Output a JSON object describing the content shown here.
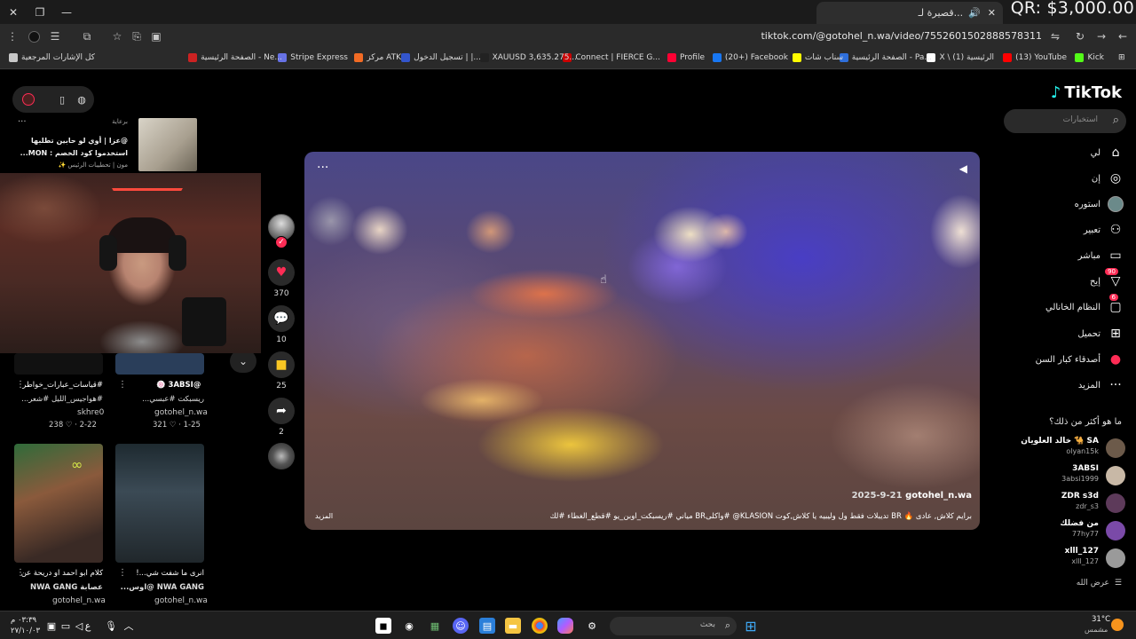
{
  "overlay": {
    "qr_text": "QR: $3,000.00"
  },
  "browser": {
    "tab_title": "...قصيرة لـ",
    "url": "tiktok.com/@gotohel_n.wa/video/7552601502888578311",
    "bookmarks": [
      {
        "label": "Kick",
        "color": "#53fc18"
      },
      {
        "label": "(13) YouTube",
        "color": "#ff0000"
      },
      {
        "label": "X \\ (1) الرئيسية",
        "color": "#ffffff"
      },
      {
        "label": "الصفحة الرئيسية - Pa...",
        "color": "#2f6fdb"
      },
      {
        "label": "سناب شات",
        "color": "#fffc00"
      },
      {
        "label": "(20+) Facebook",
        "color": "#1877f2"
      },
      {
        "label": "Profile",
        "color": "#ff0033"
      },
      {
        "label": "Connect | FIERCE G...",
        "color": "#cc0000"
      },
      {
        "label": "XAUUSD 3,635.275...",
        "color": "#222222"
      },
      {
        "label": "تسجيل الدخول | |...",
        "color": "#3355cc"
      },
      {
        "label": "مركز ATK",
        "color": "#5566dd"
      },
      {
        "label": "Stripe Express",
        "color": "#f26b24"
      },
      {
        "label": "الصفحة الرئيسية - Ne...",
        "color": "#6772e5"
      },
      {
        "label": "كل الإشارات المرجعية",
        "color": "#c8c8c8"
      }
    ]
  },
  "tiktok": {
    "logo": "TikTok",
    "search_placeholder": "استخبارات",
    "nav": [
      {
        "label": "لي",
        "icon": "home-icon"
      },
      {
        "label": "إن",
        "icon": "explore-icon"
      },
      {
        "label": "استوره",
        "icon": "profile-avatar-icon"
      },
      {
        "label": "تعبير",
        "icon": "following-icon"
      },
      {
        "label": "مباشر",
        "icon": "live-icon"
      },
      {
        "label": "إيح",
        "icon": "activity-icon",
        "badge": "90"
      },
      {
        "label": "النظام الخانالي",
        "icon": "messages-icon",
        "badge": "6"
      },
      {
        "label": "تحميل",
        "icon": "upload-icon"
      },
      {
        "label": "أصدقاء كبار السن",
        "icon": "friends-icon"
      },
      {
        "label": "المزيد",
        "icon": "more-icon"
      }
    ],
    "suggested_title": "ما هو أكثر من ذلك؟",
    "suggested": [
      {
        "name": "خالد العلويان 🐪 SA",
        "user": "olyan15k",
        "avatar_color": "#6c5a4a"
      },
      {
        "name": "3ABSI",
        "user": "3absi1999",
        "avatar_color": "#c8b8a6"
      },
      {
        "name": "ZDR s3d",
        "user": "zdr_s3",
        "avatar_color": "#5d3a5a"
      },
      {
        "name": "من فضلك",
        "user": "77hy77",
        "avatar_color": "#7a4aa8"
      },
      {
        "name": "xlll_127",
        "user": "xlll_127",
        "avatar_color": "#9a9a9a"
      }
    ],
    "show_all": "عرض الله"
  },
  "video": {
    "author": "gotohel_n.wa",
    "date": "2025-9-21",
    "caption": "برايم كلاش, عادى 🔥 BR تديبلات فقط ول وليبيه يا كلاش,كوت KLASION@ #واكلىBR مياني #ريسبكت_اوبن_يو #قطع_الغطاء #لك",
    "more_label": "المزيد",
    "likes": "370",
    "comments": "10",
    "saves": "25",
    "shares": "2"
  },
  "left": {
    "ad_label": "برعاية",
    "ad_line1": "@عزا | أوي لو حابين تطلبها",
    "ad_line2": "استخدموا كود الخصم : MON...",
    "ad_line3": "مون | تحطيبات الرئيس ✨",
    "grid": [
      {
        "title": "#قياسات_عبارات_خواطر",
        "sub": "#هواجيس_الليل #شعر...",
        "user": "skhre0",
        "stats": "238 ♡ · 2-22"
      },
      {
        "title": "@3ABSI 🍥",
        "sub": "ريسبكت #عبسي...",
        "user": "gotohel_n.wa",
        "stats": "321 ♡ · 1-25"
      },
      {
        "title": "كلام ابو احمد او دريحة عن",
        "sub": "عصابة NWA GANG",
        "user": "gotohel_n.wa",
        "stats": ""
      },
      {
        "title": "انرى ما شفت شي...!",
        "sub": "NWA GANG @اوس...",
        "user": "gotohel_n.wa",
        "stats": ""
      }
    ]
  },
  "taskbar": {
    "search_placeholder": "بحث",
    "weather_temp": "31°C",
    "weather_desc": "مشمس",
    "time": "٠٣:٣٩ م",
    "date": "٢٧/١٠/٠٣",
    "lang": "ع"
  }
}
